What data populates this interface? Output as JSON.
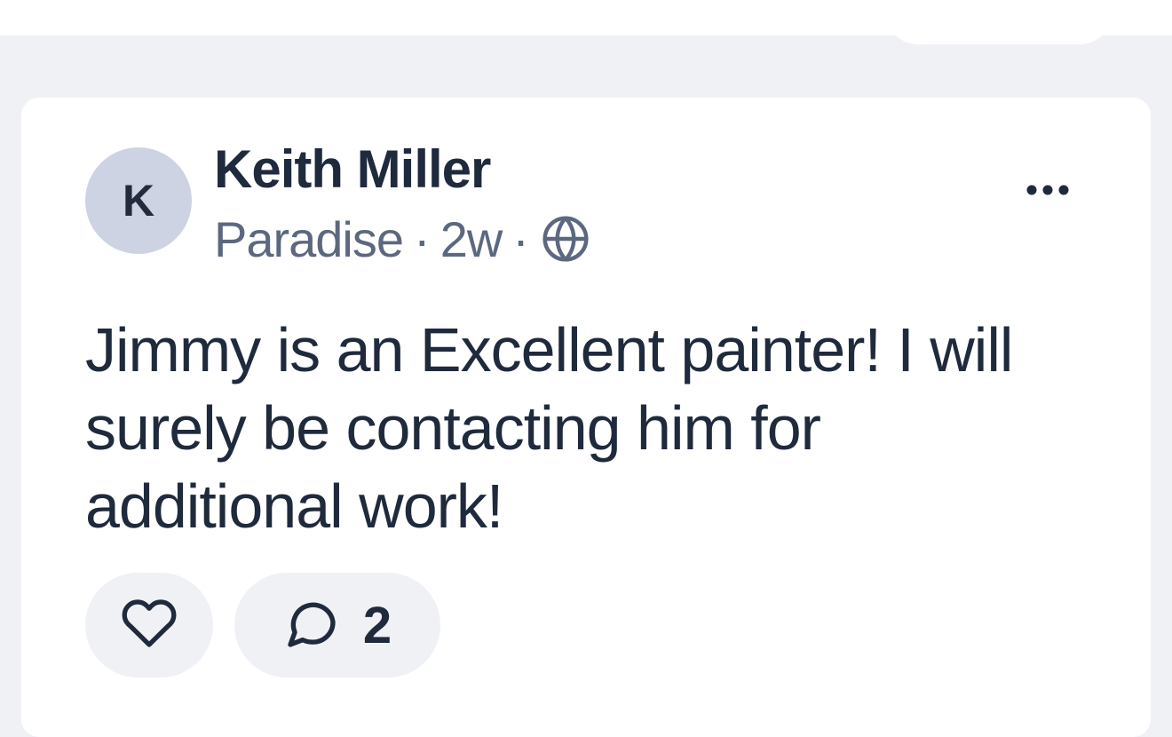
{
  "post": {
    "author": {
      "name": "Keith Miller",
      "initial": "K",
      "avatar_color": "#cdd3e2"
    },
    "meta": {
      "location": "Paradise",
      "separator": "·",
      "age": "2w",
      "visibility_icon": "globe-icon"
    },
    "body": "Jimmy is an Excellent painter! I will surely be contacting him for additional work!",
    "actions": {
      "like_icon": "heart-icon",
      "comment_icon": "comment-bubble-icon",
      "comment_count": "2",
      "more_icon": "more-horizontal-icon"
    }
  },
  "colors": {
    "page_background": "#f0f1f5",
    "card_background": "#ffffff",
    "text_primary": "#1f2a3d",
    "text_secondary": "#5c6880"
  }
}
